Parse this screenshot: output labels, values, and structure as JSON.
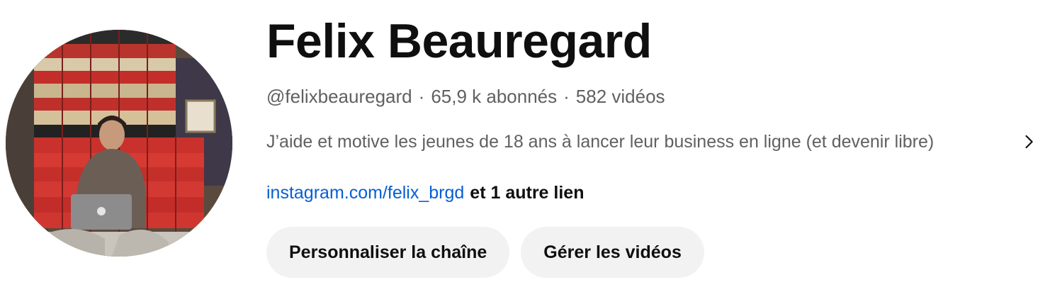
{
  "channel": {
    "name": "Felix Beauregard",
    "handle": "@felixbeauregard",
    "separator": "·",
    "subscribers": "65,9 k abonnés",
    "videos": "582 vidéos",
    "description": "J’aide et motive les jeunes de 18 ans à lancer leur business en ligne (et devenir libre)",
    "link_label": "instagram.com/felix_brgd",
    "more_links": "et 1 autre lien"
  },
  "actions": {
    "customize_label": "Personnaliser la chaîne",
    "manage_label": "Gérer les vidéos"
  },
  "icons": {
    "description_expand": "chevron-right-icon"
  },
  "colors": {
    "link": "#065fd4",
    "secondary_text": "#606060",
    "button_bg": "#f2f2f2",
    "primary_text": "#0f0f0f"
  }
}
